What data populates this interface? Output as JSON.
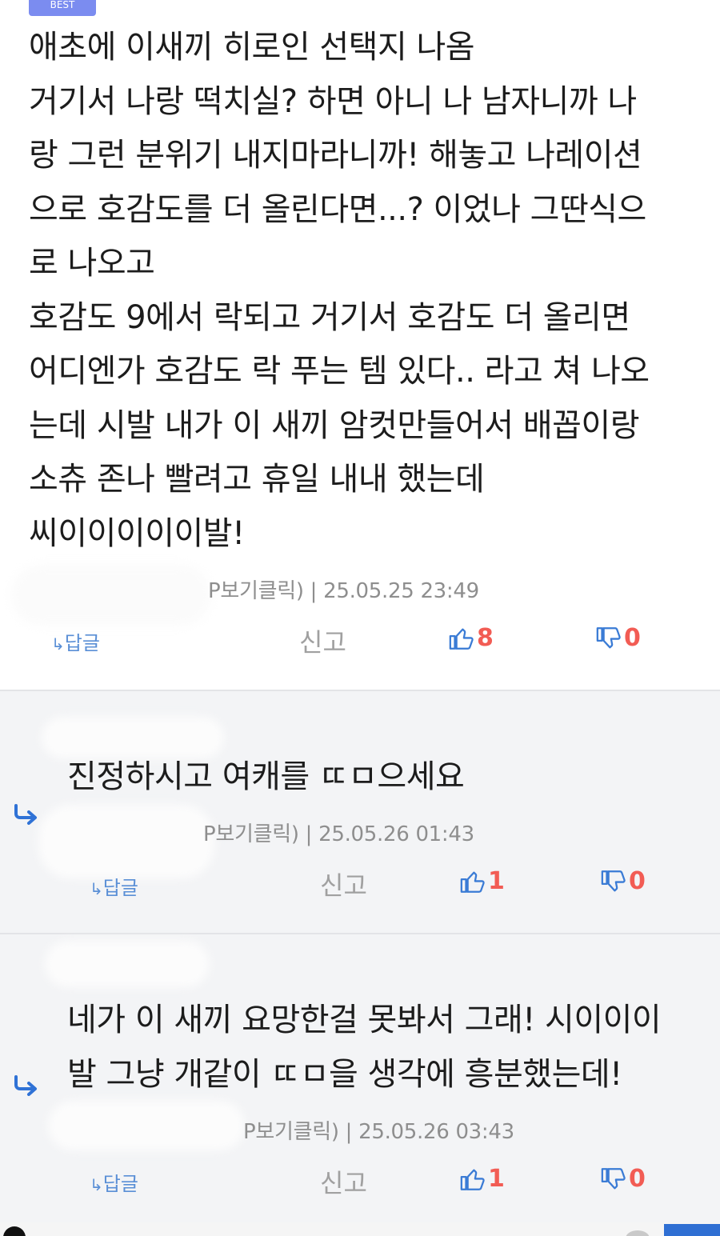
{
  "badge": {
    "label": "BEST"
  },
  "comments": [
    {
      "lines": [
        "애초에 이새끼 히로인 선택지 나옴",
        "거기서 나랑 떡치실? 하면 아니 나 남자니까 나",
        "랑 그런 분위기 내지마라니까! 해놓고 나레이션",
        "으로 호감도를 더 올린다면...? 이었나 그딴식으",
        "로 나오고",
        "호감도 9에서 락되고 거기서 호감도 더 올리면",
        "어디엔가 호감도 락 푸는 템 있다.. 라고 쳐 나오",
        "는데 시발 내가 이 새끼 암컷만들어서 배꼽이랑",
        "소츄 존나 빨려고 휴일 내내 했는데",
        "씨이이이이이발!"
      ],
      "meta": "P보기클릭) | 25.05.25 23:49",
      "reply_label": "답글",
      "report_label": "신고",
      "upvotes": "8",
      "downvotes": "0"
    },
    {
      "lines": [
        "진정하시고 여캐를 ㄸㅁ으세요"
      ],
      "meta": "P보기클릭) | 25.05.26 01:43",
      "reply_label": "답글",
      "report_label": "신고",
      "upvotes": "1",
      "downvotes": "0"
    },
    {
      "lines": [
        "네가 이 새끼 요망한걸 못봐서 그래! 시이이이",
        "발 그냥 개같이 ㄸㅁ을 생각에 흥분했는데!"
      ],
      "meta": "P보기클릭) | 25.05.26 03:43",
      "reply_label": "답글",
      "report_label": "신고",
      "upvotes": "1",
      "downvotes": "0"
    }
  ],
  "icons": {
    "reply": "reply-arrow-icon",
    "upvote": "thumbs-up-icon",
    "downvote": "thumbs-down-icon",
    "nested": "nested-reply-arrow-icon"
  },
  "colors": {
    "vote_count": "#f25c54",
    "vote_icon": "#3a7bd5",
    "reply_link": "#5a8fd6",
    "reply_bg": "#f3f4f6",
    "badge": "#7b8cf0"
  }
}
